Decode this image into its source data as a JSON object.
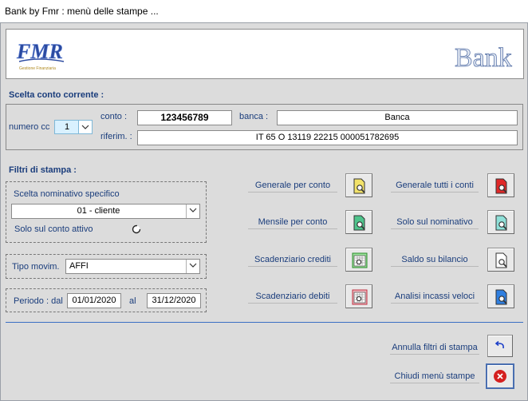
{
  "window": {
    "title": "Bank by Fmr : menù delle stampe ..."
  },
  "logos": {
    "left_text": "FMR",
    "left_subtext": "Gestione Finanziaria",
    "right_text": "Bank"
  },
  "conto_corrente": {
    "section_title": "Scelta conto corrente  :",
    "numero_cc_label": "numero cc",
    "numero_cc_value": "1",
    "conto_label": "conto    :",
    "conto_value": "123456789",
    "banca_label": "banca   :",
    "banca_value": "Banca",
    "riferim_label": "riferim.  :",
    "riferim_value": "IT 65 O 13119 22215 000051782695"
  },
  "filtri": {
    "section_title": "Filtri di stampa :",
    "nominativo_label": "Scelta nominativo specifico",
    "nominativo_value": "01 - cliente",
    "solo_attivo_label": "Solo sul conto attivo",
    "tipo_movim_label": "Tipo movim.",
    "tipo_movim_value": "AFFI",
    "periodo_dal_label": "Periodo : dal",
    "periodo_dal_value": "01/01/2020",
    "periodo_al_label": "al",
    "periodo_al_value": "31/12/2020"
  },
  "stampe": {
    "generale_per_conto": "Generale per conto",
    "mensile_per_conto": "Mensile per conto",
    "scadenziario_crediti": "Scadenziario crediti",
    "scadenziario_debiti": "Scadenziario debiti",
    "generale_tutti_conti": "Generale tutti i conti",
    "solo_nominativo": "Solo sul nominativo",
    "saldo_bilancio": "Saldo su bilancio",
    "analisi_incassi": "Analisi incassi veloci"
  },
  "footer": {
    "annulla_filtri": "Annulla filtri di stampa",
    "chiudi_menu": "Chiudi menù stampe"
  },
  "colors": {
    "accent_text": "#1a3d7c",
    "background": "#dcdcdc",
    "field_highlight": "#d9f1ff",
    "close_red": "#d42020"
  }
}
